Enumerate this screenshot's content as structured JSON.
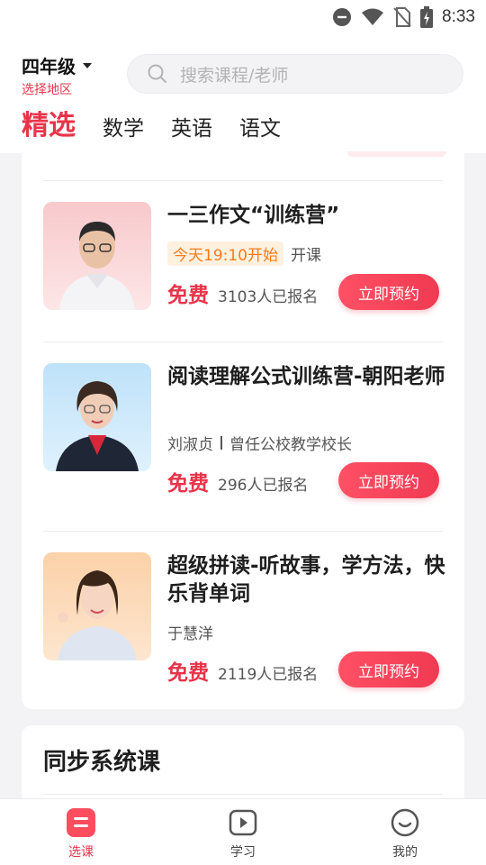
{
  "status_bar": {
    "time": "8:33",
    "icons": [
      "dnd-icon",
      "wifi-icon",
      "no-sim-icon",
      "battery-charging-icon"
    ]
  },
  "header": {
    "grade": "四年级",
    "region": "选择地区",
    "search_placeholder": "搜索课程/老师"
  },
  "tabs": [
    {
      "label": "精选",
      "active": true
    },
    {
      "label": "数学",
      "active": false
    },
    {
      "label": "英语",
      "active": false
    },
    {
      "label": "语文",
      "active": false
    }
  ],
  "courses": [
    {
      "title": "一三作文“训练营”",
      "time_tag": "今天19:10开始",
      "sub_suffix": "开课",
      "price": "免费",
      "enrolled": "3103人已报名",
      "button": "立即预约"
    },
    {
      "title": "阅读理解公式训练营-朝阳老师",
      "teacher": "刘淑贞",
      "teacher_desc": "曾任公校教学校长",
      "price": "免费",
      "enrolled": "296人已报名",
      "button": "立即预约"
    },
    {
      "title": "超级拼读-听故事，学方法，快乐背单词",
      "teacher": "于慧洋",
      "price": "免费",
      "enrolled": "2119人已报名",
      "button": "立即预约"
    }
  ],
  "sync_section": {
    "title": "同步系统课"
  },
  "bottom_nav": [
    {
      "label": "选课",
      "active": true
    },
    {
      "label": "学习",
      "active": false
    },
    {
      "label": "我的",
      "active": false
    }
  ],
  "colors": {
    "accent": "#e8344a",
    "time_tag_text": "#ff7a1a",
    "time_tag_bg": "#fff1df"
  }
}
